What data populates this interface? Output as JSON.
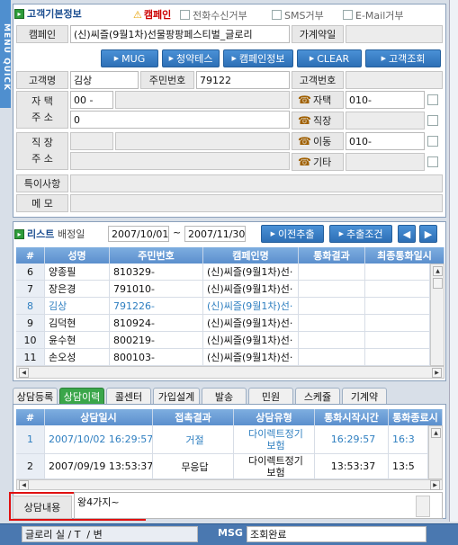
{
  "menu_quick": "MENU QUICK",
  "customer": {
    "title": "고객기본정보",
    "campaign_flag": "캠페인",
    "opt_call": "전화수신거부",
    "opt_sms": "SMS거부",
    "opt_email": "E-Mail거부",
    "campaign_label": "캠페인",
    "campaign_value": "(신)씨즐(9월1차)선물팡팡페스티벌_글로리",
    "join_label": "가계약일",
    "buttons": [
      "MUG",
      "청약테스",
      "캠페인정보",
      "CLEAR",
      "고객조회"
    ],
    "name_label": "고객명",
    "name_value": "김상",
    "rrn_label": "주민번호",
    "rrn_value": "79122",
    "custno_label": "고객번호",
    "home_addr_label": "자 택\n주 소",
    "home_zip": "00 -",
    "home_addr": "0",
    "work_addr_label": "직 장\n주 소",
    "tel_home": "자택",
    "tel_home_value": "010-",
    "tel_work": "직장",
    "tel_mobile": "이동",
    "tel_mobile_value": "010-",
    "tel_etc": "기타",
    "notes_label": "특이사항",
    "memo_label": "메 모"
  },
  "list": {
    "title": "리스트",
    "period_label": "배정일",
    "date_from": "2007/10/01",
    "tilde": "~",
    "date_to": "2007/11/30",
    "prev_btn": "이전추출",
    "cond_btn": "추출조건",
    "cols": [
      "#",
      "성명",
      "주민번호",
      "캠페인명",
      "통화결과",
      "최종통화일시"
    ],
    "rows": [
      {
        "n": "6",
        "name": "양종필",
        "rrn": "810329-",
        "camp": "(신)씨즐(9월1차)선·"
      },
      {
        "n": "7",
        "name": "장은경",
        "rrn": "791010-",
        "camp": "(신)씨즐(9월1차)선·"
      },
      {
        "n": "8",
        "name": "김상",
        "rrn": "791226-",
        "camp": "(신)씨즐(9월1차)선·"
      },
      {
        "n": "9",
        "name": "김덕현",
        "rrn": "810924-",
        "camp": "(신)씨즐(9월1차)선·"
      },
      {
        "n": "10",
        "name": "윤수현",
        "rrn": "800219-",
        "camp": "(신)씨즐(9월1차)선·"
      },
      {
        "n": "11",
        "name": "손오성",
        "rrn": "800103-",
        "camp": "(신)씨즐(9월1차)선·"
      }
    ]
  },
  "tabs": [
    "상담등록",
    "상담이력",
    "콜센터",
    "가입설계",
    "발송",
    "민원",
    "스케쥴",
    "기계약"
  ],
  "history": {
    "cols": [
      "#",
      "상담일시",
      "접촉결과",
      "상담유형",
      "통화시작시간",
      "통화종료시"
    ],
    "rows": [
      {
        "n": "1",
        "dt": "2007/10/02 16:29:57",
        "result": "거절",
        "type": "다이렉트정기\n보험",
        "start": "16:29:57",
        "end": "16:3"
      },
      {
        "n": "2",
        "dt": "2007/09/19 13:53:37",
        "result": "무응답",
        "type": "다이렉트정기\n보험",
        "start": "13:53:37",
        "end": "13:5"
      }
    ],
    "content_label": "상담내용",
    "content_value": "왕4가지~"
  },
  "status": {
    "team": "글로리",
    "sep1": "실 / T",
    "sep2": "/ 변",
    "msg_label": "MSG",
    "msg_value": "조회완료"
  }
}
